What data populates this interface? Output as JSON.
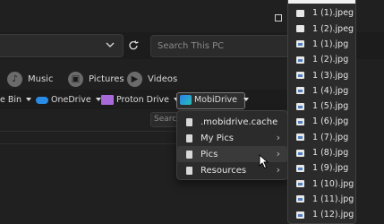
{
  "search": {
    "placeholder": "Search This PC",
    "placeholder2": "Search"
  },
  "libraries": [
    {
      "label": "Music",
      "icon": "music-icon"
    },
    {
      "label": "Pictures",
      "icon": "pictures-icon"
    },
    {
      "label": "Videos",
      "icon": "videos-icon"
    }
  ],
  "toolbar": {
    "recycle_label": "e Bin",
    "onedrive_label": "OneDrive",
    "proton_label": "Proton Drive",
    "mobidrive_label": "MobiDrive"
  },
  "menu1": {
    "items": [
      {
        "label": ".mobidrive.cache",
        "submenu": false
      },
      {
        "label": "My Pics",
        "submenu": true
      },
      {
        "label": "Pics",
        "submenu": true
      },
      {
        "label": "Resources",
        "submenu": true
      }
    ]
  },
  "menu2": {
    "items": [
      {
        "label": "1 (1).jpeg",
        "type": "file"
      },
      {
        "label": "1 (2).jpeg",
        "type": "file"
      },
      {
        "label": "1 (1).jpg",
        "type": "image"
      },
      {
        "label": "1 (2).jpg",
        "type": "image"
      },
      {
        "label": "1 (3).jpg",
        "type": "image"
      },
      {
        "label": "1 (4).jpg",
        "type": "image"
      },
      {
        "label": "1 (5).jpg",
        "type": "image"
      },
      {
        "label": "1 (6).jpg",
        "type": "image"
      },
      {
        "label": "1 (7).jpg",
        "type": "image"
      },
      {
        "label": "1 (8).jpg",
        "type": "image"
      },
      {
        "label": "1 (9).jpg",
        "type": "image"
      },
      {
        "label": "1 (10).jpg",
        "type": "image"
      },
      {
        "label": "1 (11).jpg",
        "type": "image"
      },
      {
        "label": "1 (12).jpg",
        "type": "image"
      }
    ]
  },
  "colors": {
    "accent_onedrive": "#2b8ce6",
    "proton": "#a86ad9",
    "background": "#202020"
  }
}
